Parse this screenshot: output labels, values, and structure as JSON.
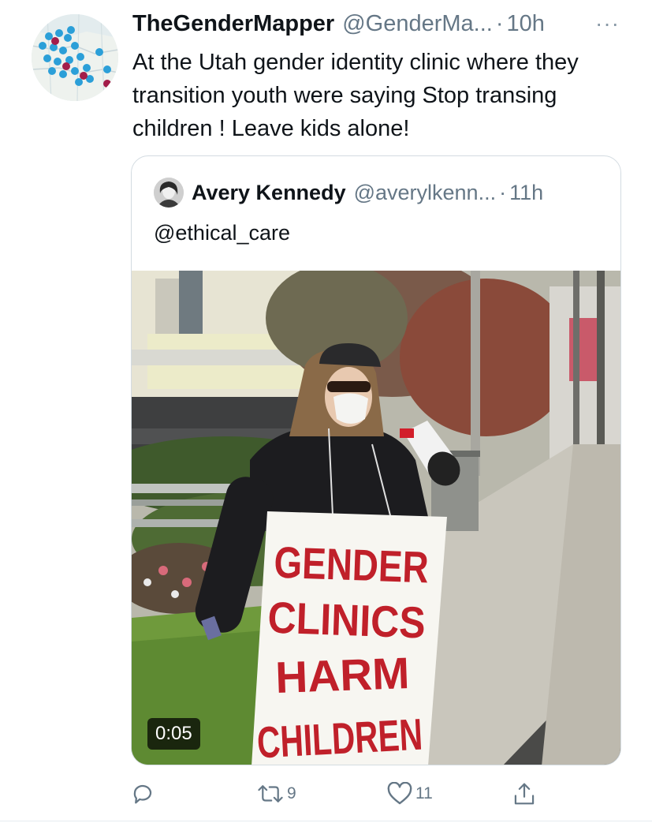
{
  "tweet": {
    "display_name": "TheGenderMapper",
    "handle": "@GenderMa...",
    "separator": "·",
    "time": "10h",
    "more": "···",
    "text": "At the Utah gender identity clinic where they transition youth were saying Stop transing children ! Leave kids alone!"
  },
  "quote": {
    "display_name": "Avery Kennedy",
    "handle": "@averylkenn...",
    "separator": "·",
    "time": "11h",
    "text": "@ethical_care",
    "video": {
      "duration": "0:05",
      "sign_lines": [
        "GENDER",
        "CLINICS",
        "HARM",
        "CHILDREN"
      ]
    }
  },
  "actions": {
    "reply_icon": "reply-icon",
    "retweet_icon": "retweet-icon",
    "retweet_count": "9",
    "like_icon": "heart-icon",
    "like_count": "11",
    "share_icon": "share-icon"
  },
  "colors": {
    "text_primary": "#0f1419",
    "text_secondary": "#657786",
    "card_border": "#d3dbe1",
    "sign_text": "#c0202a"
  }
}
